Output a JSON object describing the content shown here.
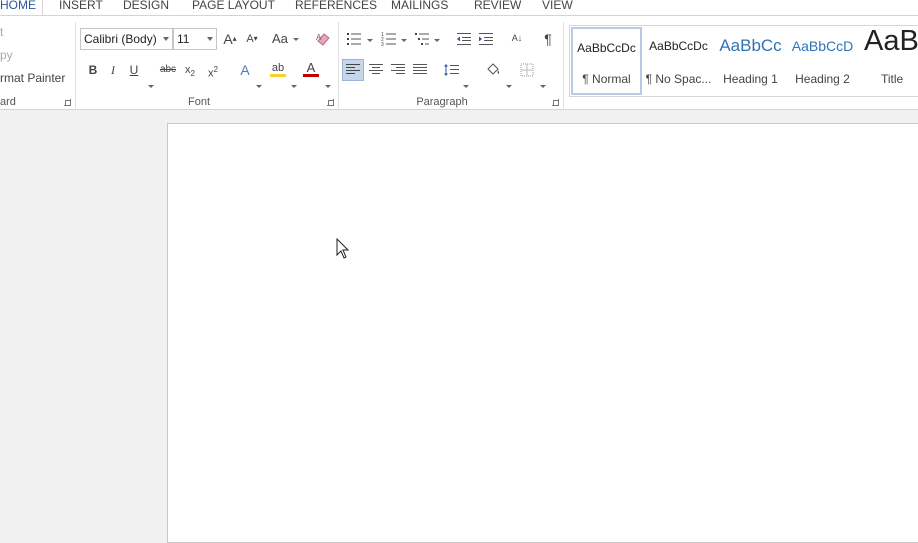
{
  "tabs": {
    "home": "HOME",
    "insert": "INSERT",
    "design": "DESIGN",
    "page_layout": "PAGE LAYOUT",
    "references": "REFERENCES",
    "mailings": "MAILINGS",
    "review": "REVIEW",
    "view": "VIEW"
  },
  "clipboard": {
    "cut": "t",
    "copy": "py",
    "format_painter": "rmat Painter",
    "group_label": "ard"
  },
  "font": {
    "font_name": "Calibri (Body)",
    "font_size": "11",
    "grow_label": "A",
    "shrink_label": "A",
    "case_label": "Aa",
    "bold": "B",
    "italic": "I",
    "underline": "U",
    "strikethrough": "abc",
    "subscript_base": "x",
    "subscript_mark": "2",
    "superscript_base": "x",
    "superscript_mark": "2",
    "effects_label": "A",
    "highlight_label": "ab",
    "font_color_label": "A",
    "group_label": "Font",
    "highlight_color": "#f5d328",
    "font_color": "#c00000"
  },
  "paragraph": {
    "sort_label": "A↓",
    "pilcrow": "¶",
    "group_label": "Paragraph"
  },
  "styles": [
    {
      "sample": "AaBbCcDc",
      "name": "¶ Normal"
    },
    {
      "sample": "AaBbCcDc",
      "name": "¶ No Spac..."
    },
    {
      "sample": "AaBbCc",
      "name": "Heading 1"
    },
    {
      "sample": "AaBbCcD",
      "name": "Heading 2"
    },
    {
      "sample": "AaB",
      "name": "Title"
    }
  ],
  "colors": {
    "accent": "#2b579a",
    "heading_blue": "#2e74b5"
  }
}
